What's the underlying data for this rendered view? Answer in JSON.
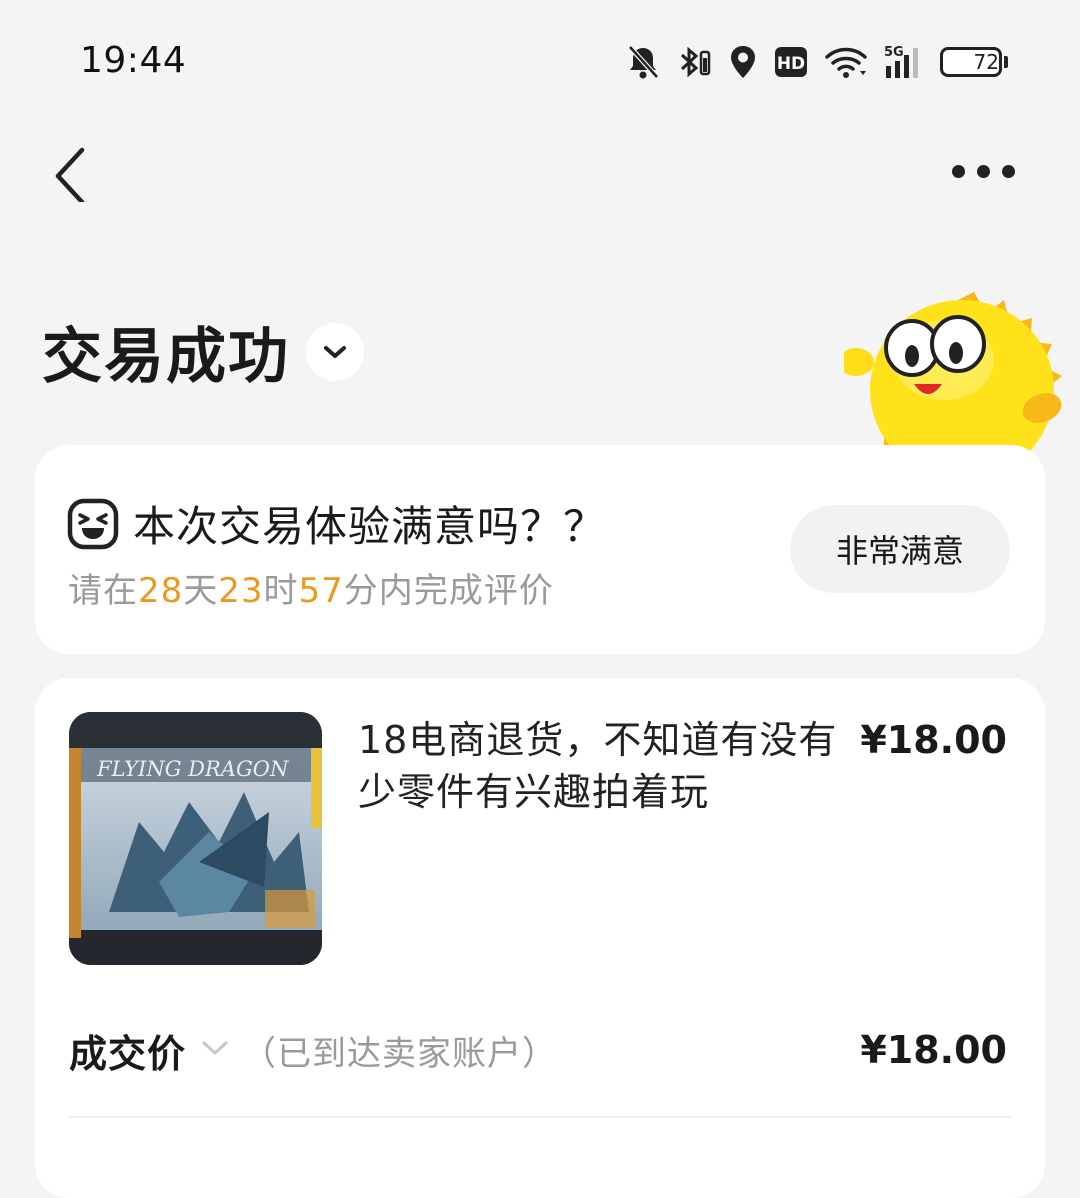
{
  "status_bar": {
    "time": "19:44",
    "network": "5G",
    "hd_label": "HD",
    "battery": "72",
    "battery_level": 0.72,
    "icons": [
      "mute-bell-icon",
      "bluetooth-icon",
      "location-icon",
      "hd-icon",
      "wifi-icon",
      "signal-icon",
      "battery-icon"
    ]
  },
  "nav": {
    "back_icon": "chevron-left-icon",
    "more_icon": "more-dots-icon"
  },
  "header": {
    "title": "交易成功",
    "toggle_icon": "chevron-down-icon"
  },
  "evaluation": {
    "question": "本次交易体验满意吗？？",
    "deadline_prefix": "请在",
    "days": "28",
    "days_unit": "天",
    "hours": "23",
    "hours_unit": "时",
    "minutes": "57",
    "deadline_suffix": "分内完成评价",
    "button_label": "非常满意",
    "emoji_icon": "laughing-face-icon",
    "highlight_color": "#ec9a1f"
  },
  "order": {
    "product_title": "18电商退货，不知道有没有少零件有兴趣拍着玩",
    "product_price": "¥18.00",
    "image_text": "FLYING DRAGON",
    "deal_label": "成交价",
    "deal_note": "（已到达卖家账户）",
    "deal_price": "¥18.00"
  }
}
